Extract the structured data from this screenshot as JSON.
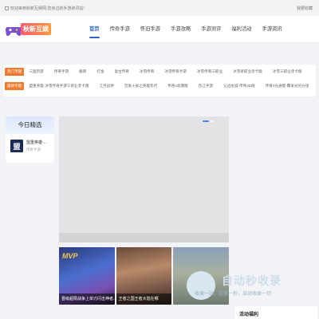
{
  "topbar": {
    "welcome": "欢迎来到秋新互娱网,您身边的手游资讯站!",
    "favorite": "我要收藏"
  },
  "logo": {
    "text": "秋新互娱"
  },
  "nav": [
    "首页",
    "传奇手游",
    "怀旧手游",
    "手游攻略",
    "手游测评",
    "福利活动",
    "手游资讯"
  ],
  "tags": {
    "hot": {
      "label": "热门专题",
      "items": [
        "三国页游",
        "传奇手游",
        "搬砖",
        "打金",
        "复古传奇",
        "冰雪传奇",
        "冰雪传奇手游",
        "冰雪传奇三职业",
        "冰雪单职业赤卡版",
        "冰雪三职业赤卡版"
      ]
    },
    "latest": {
      "label": "最新专题",
      "items": [
        "盟重英雄-冰雪传奇手游三职业赤卡版",
        "江月战神",
        "百鬼十族之英雄年代",
        "传奇3高爆版",
        "热江手游",
        "父战龙城-传奇3D版",
        "传奇3光通版-覆发光的分组"
      ]
    }
  },
  "today": {
    "title": "今日精选",
    "item_name": "盟重英雄-...",
    "item_sub": "传奇手游",
    "item_glyph": "盟"
  },
  "gallery": [
    {
      "label": "晋级超限战争上单刃闪击神者..."
    },
    {
      "label": "王者之国王者大陆在哪"
    },
    {
      "label": ""
    }
  ],
  "watermark": {
    "main": "自动秒收录",
    "slogan": "收录一站，流量一秒，自动收录一切"
  },
  "activity": {
    "title": "活动福利"
  },
  "colors": {
    "accent": "#2d64c8",
    "tag_orange": "#f07a30",
    "logo_gradient": [
      "#ff5a6e",
      "#ff9a3c"
    ]
  }
}
